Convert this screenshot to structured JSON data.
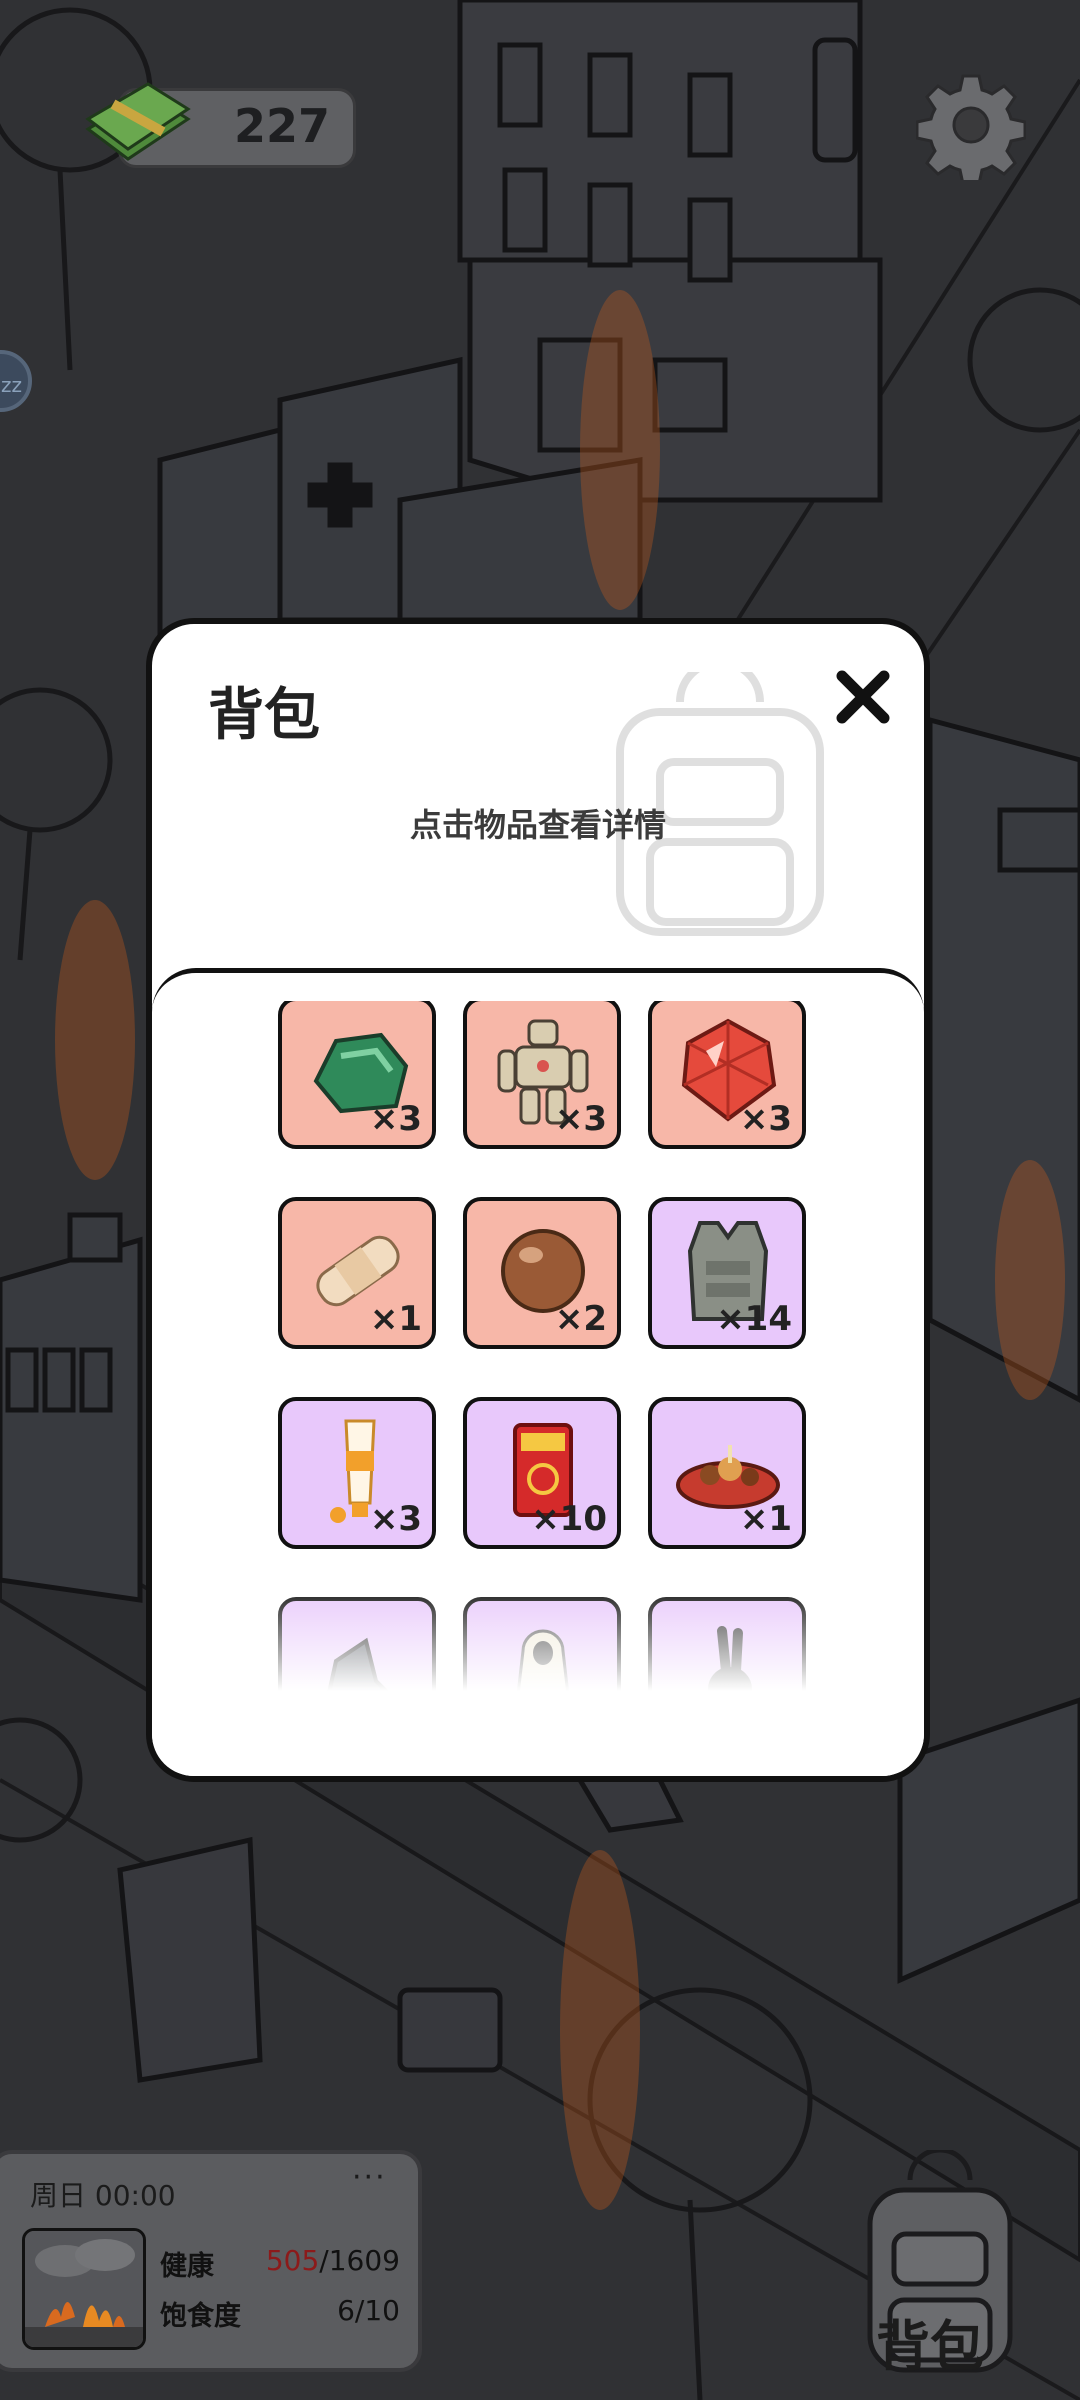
{
  "hud": {
    "money": "227",
    "money_icon": "cash-stack-icon",
    "settings_icon": "gear-icon",
    "badge_text": "zz"
  },
  "inventory": {
    "title": "背包",
    "hint": "点击物品查看详情",
    "close_icon": "close-x-icon",
    "items": [
      {
        "name": "jade-stone",
        "qty": "×3",
        "rarity": "red"
      },
      {
        "name": "mech-robot-figure",
        "qty": "×3",
        "rarity": "red"
      },
      {
        "name": "red-gem",
        "qty": "×3",
        "rarity": "red"
      },
      {
        "name": "bandage",
        "qty": "×1",
        "rarity": "red"
      },
      {
        "name": "brown-ball",
        "qty": "×2",
        "rarity": "red"
      },
      {
        "name": "body-armor-vest",
        "qty": "×14",
        "rarity": "purple"
      },
      {
        "name": "sunscreen-tube",
        "qty": "×3",
        "rarity": "purple"
      },
      {
        "name": "red-envelope",
        "qty": "×10",
        "rarity": "purple"
      },
      {
        "name": "food-platter",
        "qty": "×1",
        "rarity": "purple"
      },
      {
        "name": "boot",
        "qty": "",
        "rarity": "purple"
      },
      {
        "name": "hooded-figure",
        "qty": "",
        "rarity": "purple"
      },
      {
        "name": "rabbit-toy",
        "qty": "",
        "rarity": "purple"
      }
    ]
  },
  "status": {
    "time": "周日 00:00",
    "more": "···",
    "health_label": "健康",
    "health_current": "505",
    "health_max": "/1609",
    "satiety_label": "饱食度",
    "satiety_value": "6/10"
  },
  "backpack_button": {
    "label": "背包"
  },
  "colors": {
    "rarity_red": "#f7b7a8",
    "rarity_purple": "#e8c8fb",
    "health_current": "#8c1a1a"
  }
}
